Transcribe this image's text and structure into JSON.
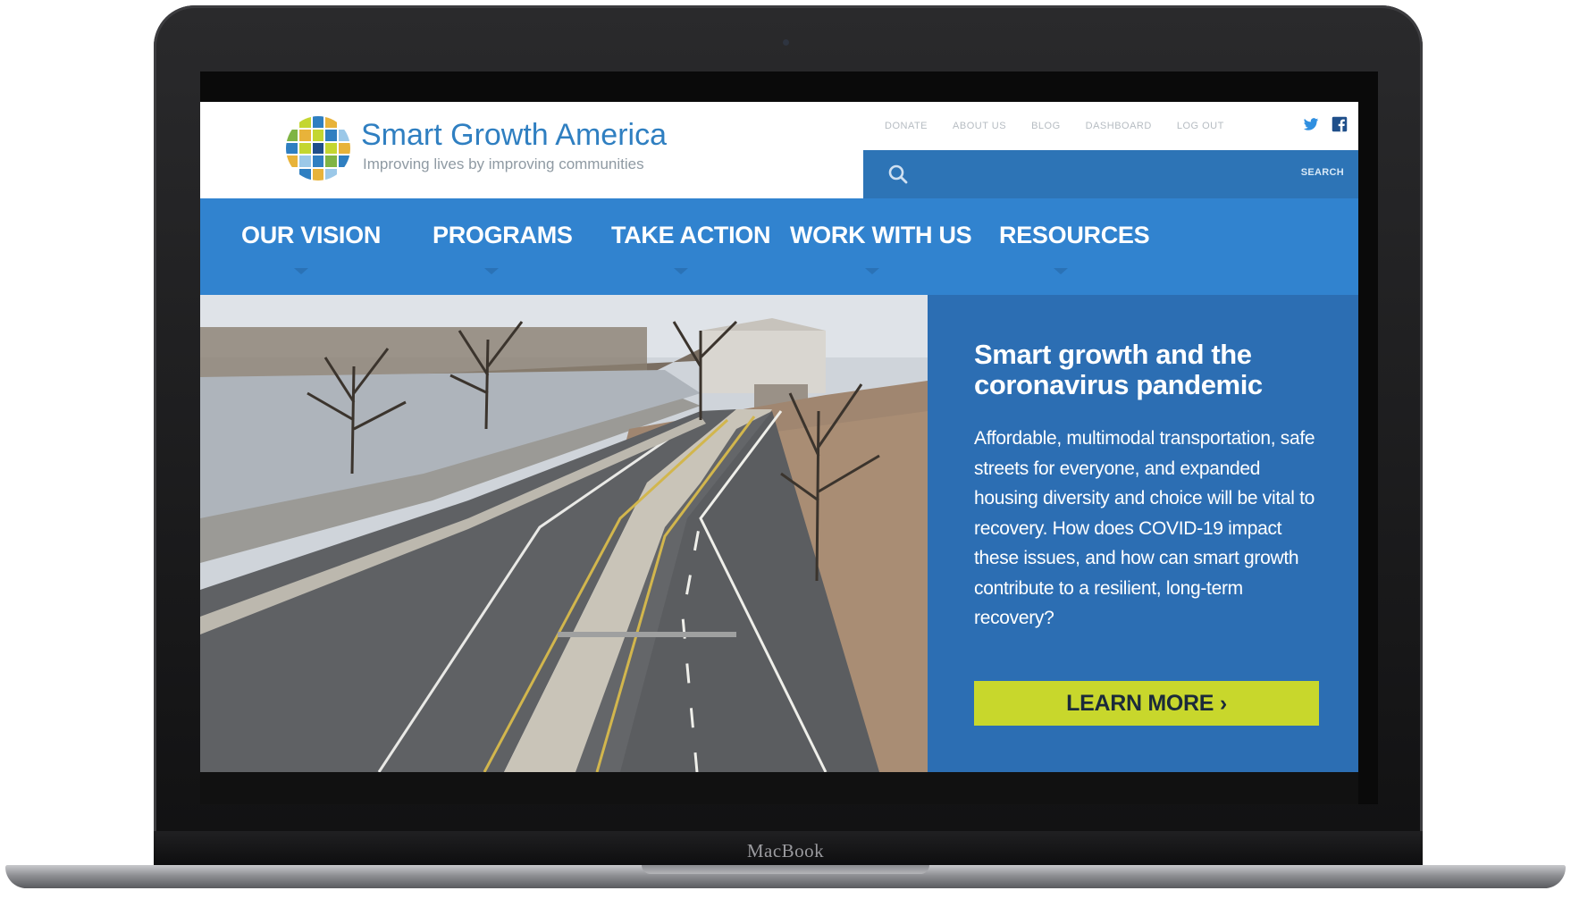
{
  "device": {
    "brand_label": "MacBook"
  },
  "header": {
    "logo_title": "Smart Growth America",
    "logo_tagline": "Improving lives by improving communities",
    "utility_links": [
      "DONATE",
      "ABOUT US",
      "BLOG",
      "DASHBOARD",
      "LOG OUT"
    ],
    "social_icons": [
      "twitter-icon",
      "facebook-icon"
    ],
    "search": {
      "placeholder": "",
      "button_label": "SEARCH"
    }
  },
  "nav": {
    "items": [
      {
        "label": "OUR VISION"
      },
      {
        "label": "PROGRAMS"
      },
      {
        "label": "TAKE ACTION"
      },
      {
        "label": "WORK WITH US"
      },
      {
        "label": "RESOURCES"
      }
    ]
  },
  "hero": {
    "heading": "Smart growth and the coronavirus pandemic",
    "body": "Affordable, multimodal transportation, safe streets for everyone, and expanded housing diversity and choice will be vital to recovery. How does COVID-19 impact these issues, and how can smart growth contribute to a resilient, long-term recovery?",
    "cta_label": "LEARN MORE ›"
  },
  "colors": {
    "brand_blue": "#3183cf",
    "hero_blue": "#2c6eb3",
    "cta_green": "#c8d72c"
  }
}
